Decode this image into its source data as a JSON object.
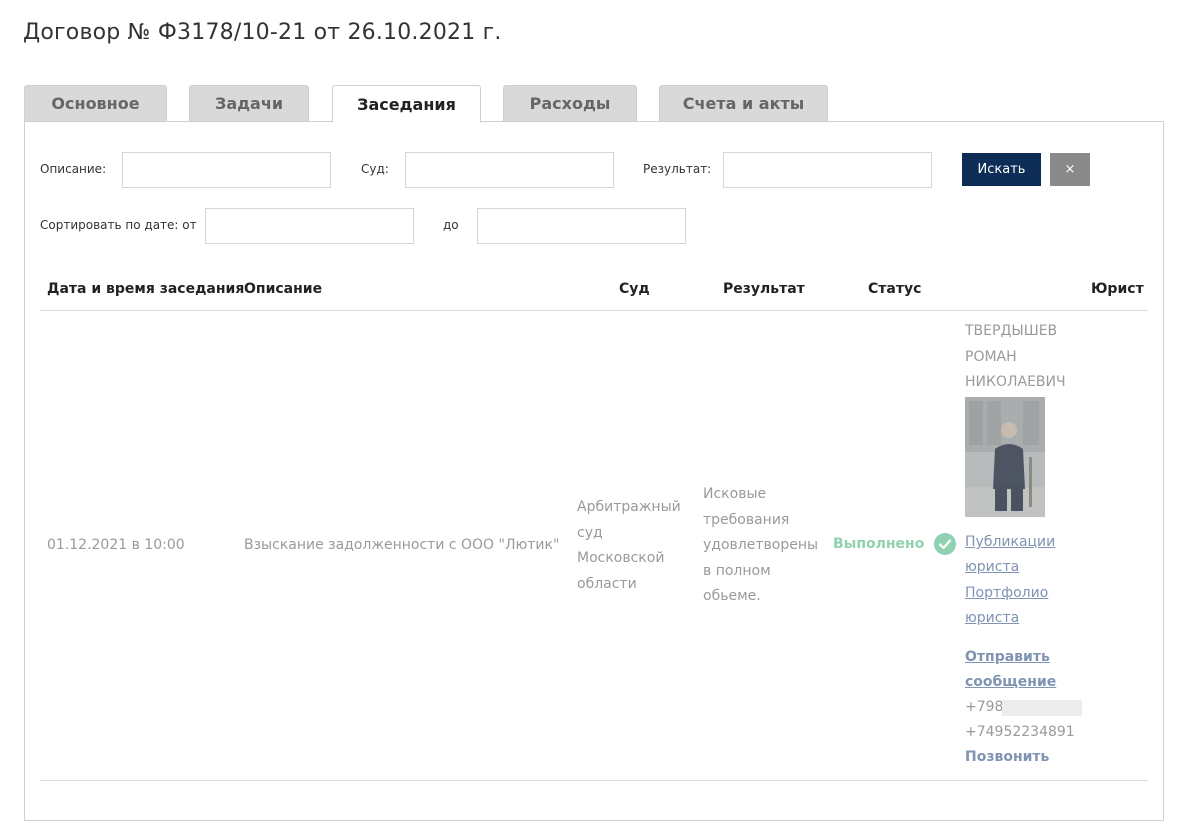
{
  "page": {
    "title": "Договор № Ф3178/10-21 от 26.10.2021 г."
  },
  "tabs": [
    {
      "label": "Основное",
      "active": false
    },
    {
      "label": "Задачи",
      "active": false
    },
    {
      "label": "Заседания",
      "active": true
    },
    {
      "label": "Расходы",
      "active": false
    },
    {
      "label": "Счета и акты",
      "active": false
    }
  ],
  "filters": {
    "description_label": "Описание:",
    "description_value": "",
    "court_label": "Суд:",
    "court_value": "",
    "result_label": "Результат:",
    "result_value": "",
    "sort_from_label": "Сортировать по дате: от",
    "sort_from_value": "",
    "sort_to_label": "до",
    "sort_to_value": "",
    "search_label": "Искать",
    "clear_label": "×"
  },
  "table": {
    "headers": {
      "datetime": "Дата и время заседания",
      "description": "Описание",
      "court": "Суд",
      "result": "Результат",
      "status": "Статус",
      "lawyer": "Юрист"
    },
    "rows": [
      {
        "datetime": "01.12.2021 в 10:00",
        "description": "Взыскание задолженности с ООО \"Лютик\"",
        "court": [
          "Арбитражный",
          "суд",
          "Московской",
          "области"
        ],
        "result": [
          "Исковые",
          "требования",
          "удовлетворены",
          "в полном",
          "обьеме."
        ],
        "status": "Выполнено",
        "lawyer": {
          "name": [
            "ТВЕРДЫШЕВ",
            "РОМАН",
            "НИКОЛАЕВИЧ"
          ],
          "publications": [
            "Публикации",
            "юриста"
          ],
          "portfolio": [
            "Портфолио",
            "юриста"
          ],
          "message": [
            "Отправить",
            "сообщение"
          ],
          "phone_partial": "+798",
          "phone": "+74952234891",
          "call": "Позвонить"
        }
      }
    ]
  },
  "colors": {
    "accent_button": "#0d2d56",
    "clear_button": "#8a8a8a",
    "status_done": "#8fd1b0",
    "link": "#7f93b2"
  }
}
